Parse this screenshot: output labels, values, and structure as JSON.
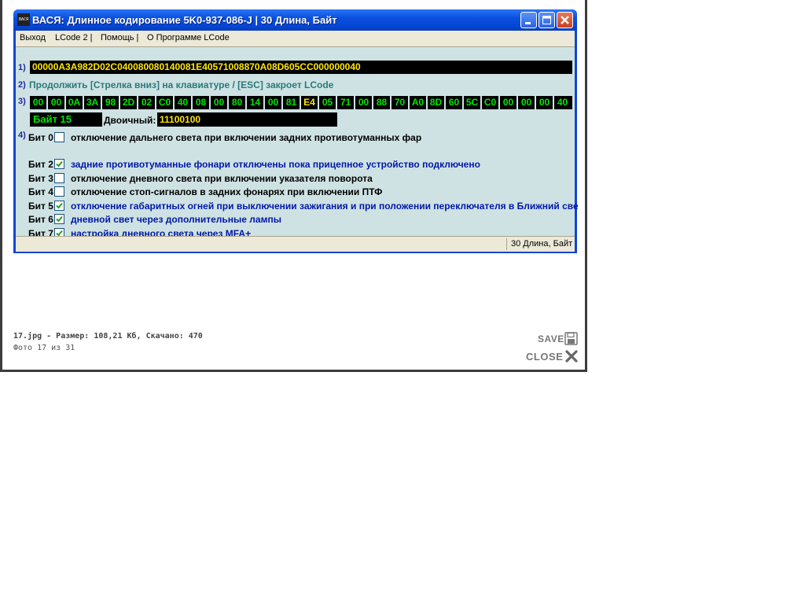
{
  "window": {
    "app_icon_text": "ВАСЯ",
    "title": "ВАСЯ: Длинное кодирование  5K0-937-086-J |  30 Длина, Байт"
  },
  "menu": {
    "items": [
      "Выход",
      "LCode 2 |",
      "Помощь |",
      "О Программе LCode"
    ]
  },
  "sections": {
    "n1": "1)",
    "n2": "2)",
    "n3": "3)",
    "n4": "4)"
  },
  "coding_string": "00000A3A982D02C040080080140081E40571008870A08D605CC000000040",
  "hint": "Продолжить [Стрелка вниз] на клавиатуре / [ESC] закроет LCode",
  "bytes": [
    "00",
    "00",
    "0A",
    "3A",
    "98",
    "2D",
    "02",
    "C0",
    "40",
    "08",
    "00",
    "80",
    "14",
    "00",
    "81",
    "E4",
    "05",
    "71",
    "00",
    "88",
    "70",
    "A0",
    "8D",
    "60",
    "5C",
    "C0",
    "00",
    "00",
    "00",
    "40"
  ],
  "selected_byte_index": 15,
  "byte_label": "Байт 15",
  "binary_caption": "Двоичный:",
  "binary_value": "11100100",
  "bits": [
    {
      "label": "Бит 0",
      "checked": false,
      "text": "отключение дальнего света при включении задних противотуманных фар"
    },
    {
      "label": "Бит 2",
      "checked": true,
      "text": "задние противотуманные фонари отключены пока прицепное устройство подключено"
    },
    {
      "label": "Бит 3",
      "checked": false,
      "text": "отключение дневного света при включении указателя поворота"
    },
    {
      "label": "Бит 4",
      "checked": false,
      "text": "отключение стоп-сигналов в задних фонарях при включении ПТФ"
    },
    {
      "label": "Бит 5",
      "checked": true,
      "text": "отключение габаритных огней при выключении зажигания и при положении переключателя в Ближний све"
    },
    {
      "label": "Бит 6",
      "checked": true,
      "text": "дневной свет через дополнительные лампы"
    },
    {
      "label": "Бит 7",
      "checked": true,
      "text": "настройка дневного света через MFA+"
    }
  ],
  "status": "30 Длина, Байт",
  "caption": "17.jpg - Размер: 108,21 Кб, Скачано: 470",
  "counter": "Фото 17 из 31",
  "save_label": "SAVE",
  "close_label": "CLOSE",
  "colors": {
    "titlebar": "#0a50de",
    "client_bg": "#cfe2e3",
    "byte_text": "#00e600",
    "selected_text": "#ffe600",
    "checked_text": "#0018a8"
  }
}
